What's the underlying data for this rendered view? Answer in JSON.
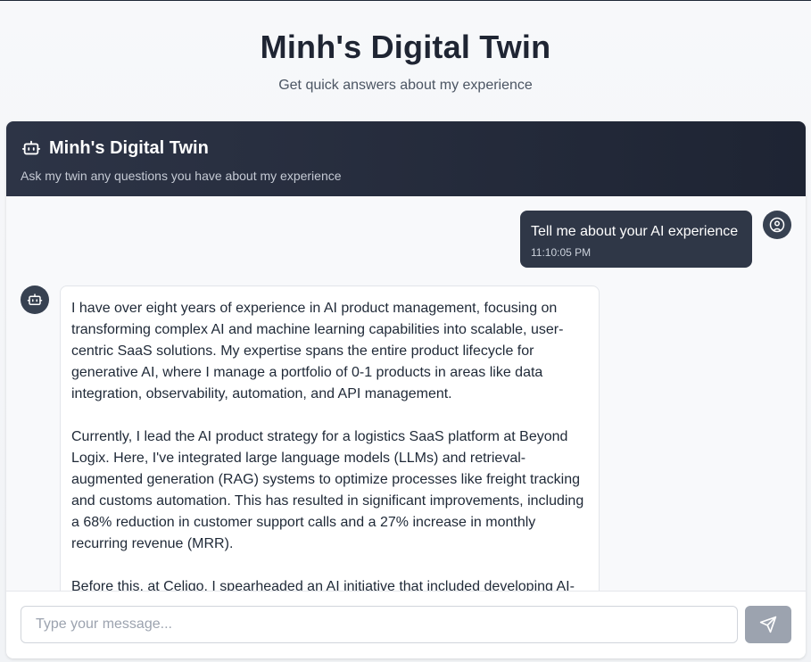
{
  "page": {
    "title": "Minh's Digital Twin",
    "subtitle": "Get quick answers about my experience"
  },
  "chat": {
    "header": {
      "icon": "bot-icon",
      "title": "Minh's Digital Twin",
      "subtitle": "Ask my twin any questions you have about my experience"
    },
    "messages": [
      {
        "role": "user",
        "avatar_icon": "user-icon",
        "text": "Tell me about your AI experience",
        "time": "11:10:05 PM"
      },
      {
        "role": "assistant",
        "avatar_icon": "bot-icon",
        "paragraphs": [
          "I have over eight years of experience in AI product management, focusing on transforming complex AI and machine learning capabilities into scalable, user-centric SaaS solutions. My expertise spans the entire product lifecycle for generative AI, where I manage a portfolio of 0-1 products in areas like data integration, observability, automation, and API management.",
          "Currently, I lead the AI product strategy for a logistics SaaS platform at Beyond Logix. Here, I've integrated large language models (LLMs) and retrieval-augmented generation (RAG) systems to optimize processes like freight tracking and customs automation. This has resulted in significant improvements, including a 68% reduction in customer support calls and a 27% increase in monthly recurring revenue (MRR).",
          "Before this, at Celigo, I spearheaded an AI initiative that included developing AI-"
        ]
      }
    ],
    "input": {
      "placeholder": "Type your message...",
      "value": ""
    },
    "send_icon": "send-icon"
  },
  "colors": {
    "header_bg": "#1e2433",
    "user_bubble": "#2f3747",
    "send_button": "#9ca3af"
  }
}
